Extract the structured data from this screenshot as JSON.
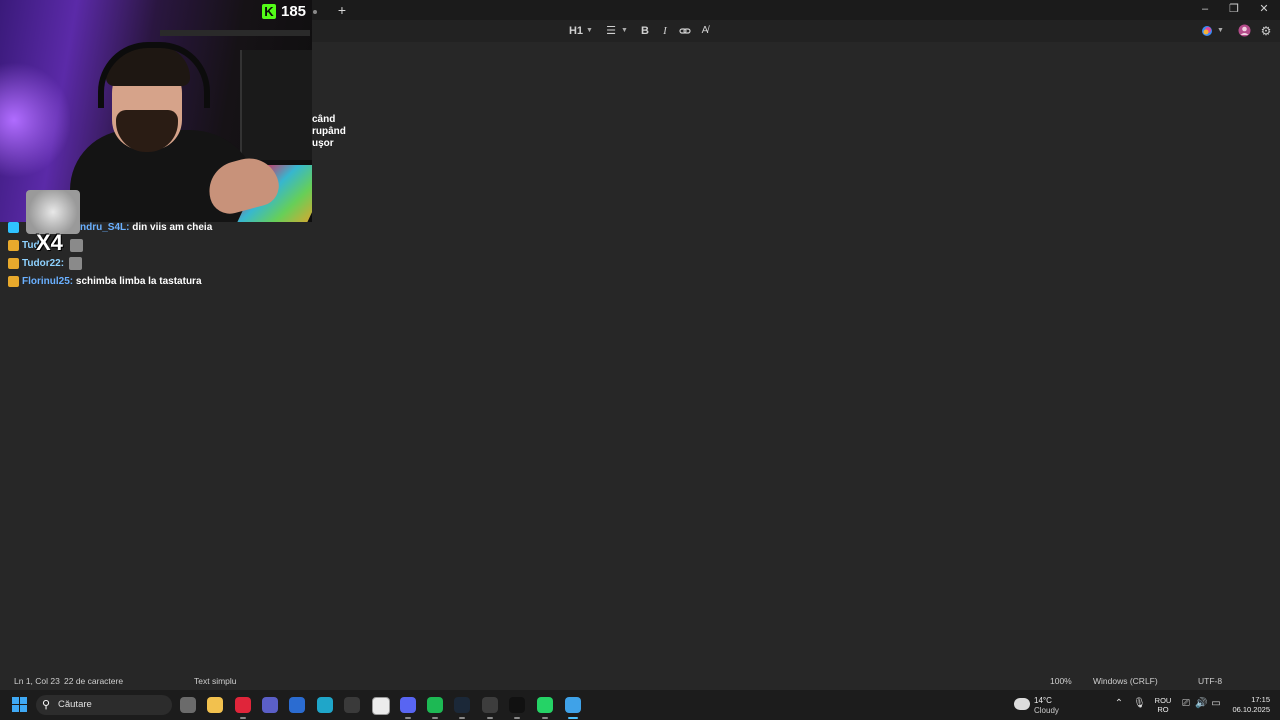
{
  "titlebar": {
    "new_tab_label": "+",
    "minimize_label": "–",
    "restore_label": "❐",
    "close_label": "✕"
  },
  "toolbar": {
    "heading_label": "H1",
    "list_icon": "list-icon",
    "bold_label": "B",
    "italic_label": "I",
    "link_icon": "link-icon",
    "clear_format_icon": "clear-format-icon",
    "copilot_icon": "copilot-icon",
    "profile_icon": "profile-icon",
    "settings_icon": "gear-icon"
  },
  "editor": {
    "fragments": [
      "când",
      "rupând",
      "uşor"
    ]
  },
  "stream_overlay": {
    "viewer_badge_logo": "K",
    "viewer_count": "185",
    "sticker_text": "X4",
    "chat": [
      {
        "badge": "grid",
        "user": "ndru_S4L:",
        "message": "din viis am cheia",
        "emote": false
      },
      {
        "badge": "crown",
        "user": "Tud",
        "message": "",
        "emote": true
      },
      {
        "badge": "crown",
        "user": "Tudor22:",
        "message": "",
        "emote": true
      },
      {
        "badge": "crown",
        "user": "Florinul25:",
        "message": "schimba limba la tastatura",
        "emote": false
      }
    ]
  },
  "statusbar": {
    "position": "Ln 1, Col 23",
    "char_count": "22 de caractere",
    "format": "Text simplu",
    "zoom": "100%",
    "line_ending": "Windows (CRLF)",
    "encoding": "UTF-8"
  },
  "taskbar": {
    "search_placeholder": "Căutare",
    "apps": [
      {
        "name": "task-view",
        "color": "#6b6b6b"
      },
      {
        "name": "file-explorer",
        "color": "#f2c14e"
      },
      {
        "name": "opera-gx",
        "color": "#e0253a"
      },
      {
        "name": "teams",
        "color": "#5b5fc7"
      },
      {
        "name": "word",
        "color": "#2b6cd1"
      },
      {
        "name": "edge",
        "color": "#1fa6c9"
      },
      {
        "name": "unity",
        "color": "#3a3a3a"
      },
      {
        "name": "microsoft-store",
        "color": "#ececec"
      },
      {
        "name": "discord",
        "color": "#5865f2"
      },
      {
        "name": "spotify",
        "color": "#1db954"
      },
      {
        "name": "steam",
        "color": "#1b2838"
      },
      {
        "name": "obs",
        "color": "#3d3d3d"
      },
      {
        "name": "capcut",
        "color": "#111111"
      },
      {
        "name": "whatsapp",
        "color": "#25d366"
      },
      {
        "name": "notepad",
        "color": "#3fa2e8"
      }
    ],
    "weather_temp": "14°C",
    "weather_desc": "Cloudy",
    "lang_top": "ROU",
    "lang_bottom": "RO",
    "time": "17:15",
    "date": "06.10.2025"
  }
}
